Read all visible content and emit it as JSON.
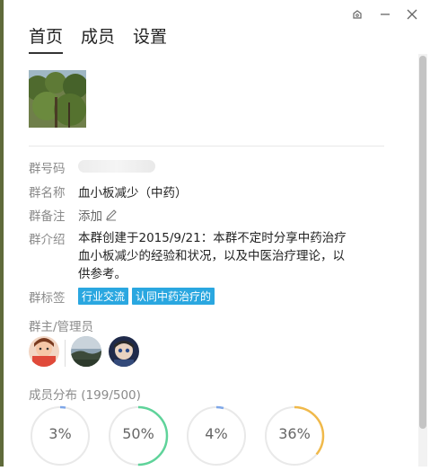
{
  "tabs": [
    {
      "label": "首页"
    },
    {
      "label": "成员"
    },
    {
      "label": "设置"
    }
  ],
  "info": {
    "group_number_label": "群号码",
    "group_name_label": "群名称",
    "group_name": "血小板减少（中药）",
    "remark_label": "群备注",
    "remark_add": "添加",
    "intro_label": "群介绍",
    "intro_line1": "本群创建于2015/9/21：本群不定时分享中药治疗",
    "intro_line2": "血小板减少的经验和状况，以及中医治疗理论，以",
    "intro_line3": "供参考。",
    "tags_label": "群标签",
    "tags": [
      "行业交流",
      "认同中药治疗的"
    ]
  },
  "admins": {
    "title": "群主/管理员"
  },
  "distribution": {
    "title": "成员分布 (199/500)",
    "rings": [
      {
        "label": "3%",
        "percent": 3,
        "color": "#7fa7e8"
      },
      {
        "label": "50%",
        "percent": 50,
        "color": "#5fd39a"
      },
      {
        "label": "4%",
        "percent": 4,
        "color": "#7fa7e8"
      },
      {
        "label": "36%",
        "percent": 36,
        "color": "#f0b94a"
      }
    ]
  },
  "colors": {
    "tag_bg": "#2aa7e0",
    "ring_track": "#e9e9e9"
  }
}
